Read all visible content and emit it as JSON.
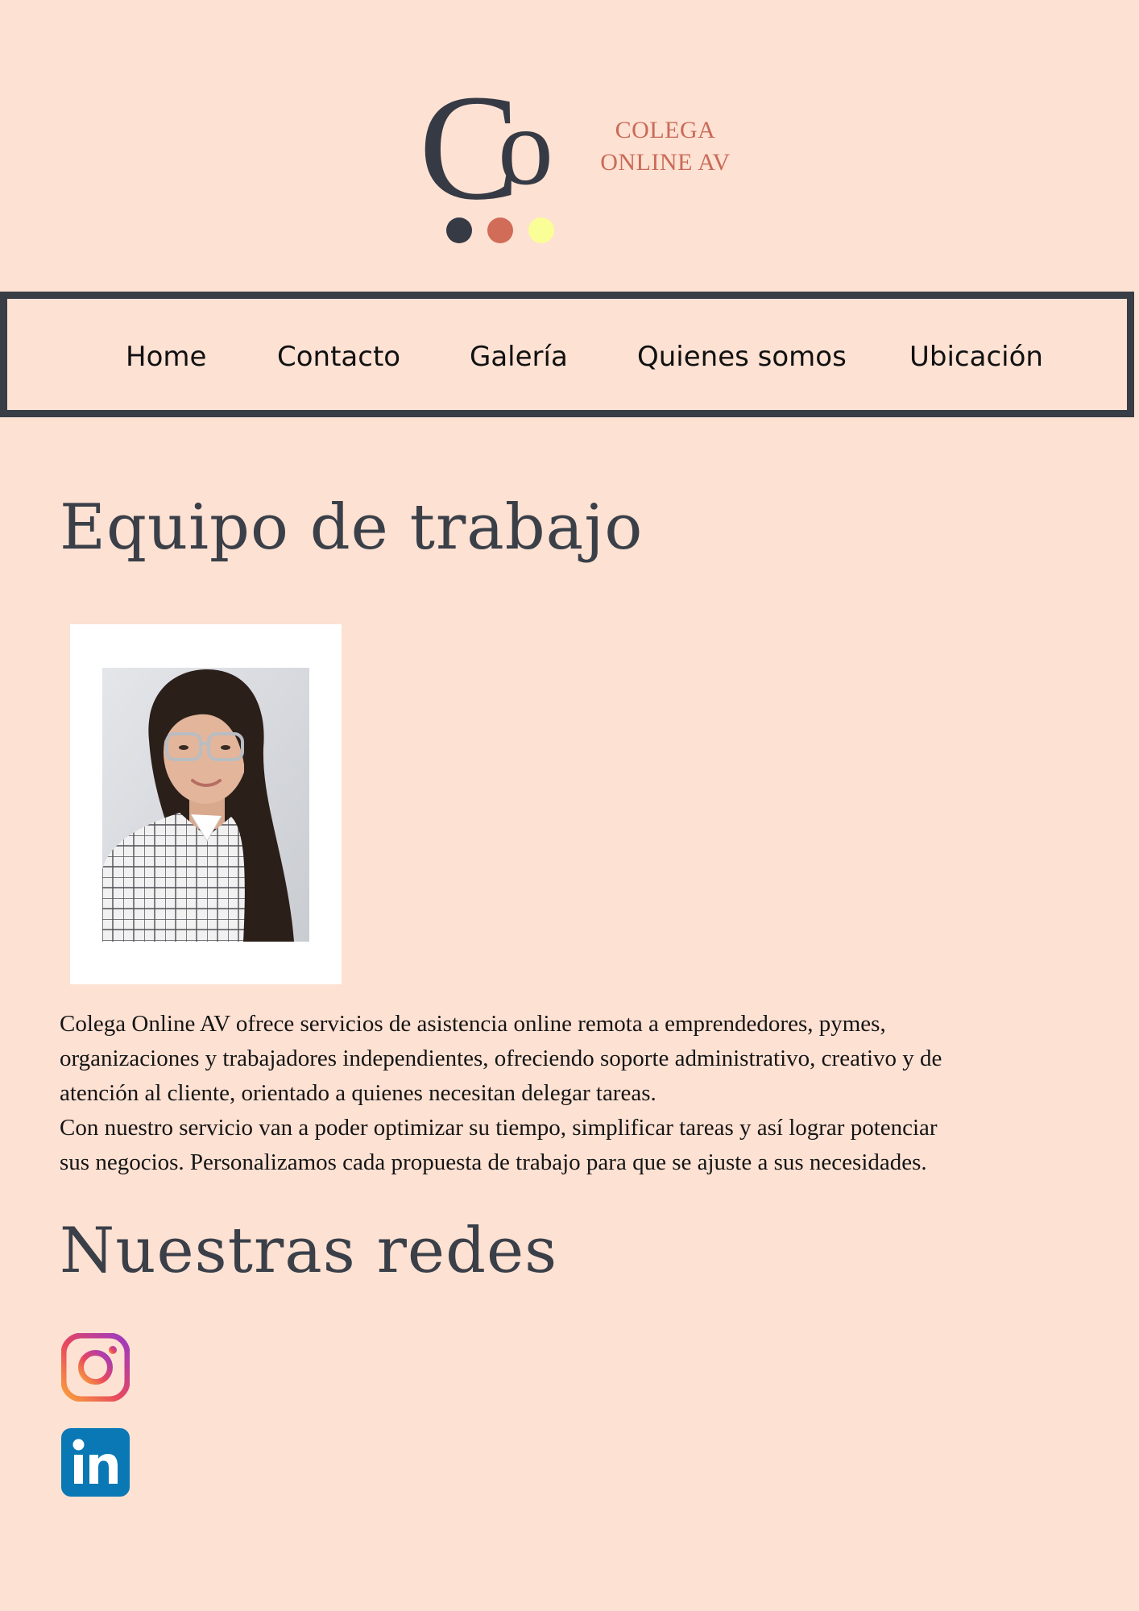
{
  "logo": {
    "line1": "COLEGA",
    "line2": "ONLINE AV",
    "colors": {
      "mark": "#353a45",
      "text": "#c96b57",
      "dot1": "#353a45",
      "dot2": "#d06c58",
      "dot3": "#fafe96"
    }
  },
  "nav": {
    "items": [
      {
        "label": "Home"
      },
      {
        "label": "Contacto"
      },
      {
        "label": "Galería"
      },
      {
        "label": "Quienes somos"
      },
      {
        "label": "Ubicación"
      }
    ]
  },
  "team": {
    "heading": "Equipo de trabajo",
    "photo_alt": "team-member-photo"
  },
  "about": {
    "lines": [
      "Colega Online AV ofrece servicios de asistencia online remota a emprendedores, pymes,",
      "organizaciones y trabajadores independientes, ofreciendo soporte administrativo, creativo y de",
      "atención al cliente, orientado a quienes necesitan delegar tareas.",
      "Con nuestro servicio van a poder optimizar su tiempo, simplificar tareas y así lograr potenciar",
      "sus negocios. Personalizamos cada propuesta de trabajo para que se ajuste a sus necesidades."
    ]
  },
  "social": {
    "heading": "Nuestras redes",
    "links": [
      {
        "icon": "instagram-icon"
      },
      {
        "icon": "linkedin-icon"
      }
    ]
  },
  "colors": {
    "background": "#fde1d3",
    "heading": "#3a3f48",
    "nav_border": "#383d46"
  }
}
